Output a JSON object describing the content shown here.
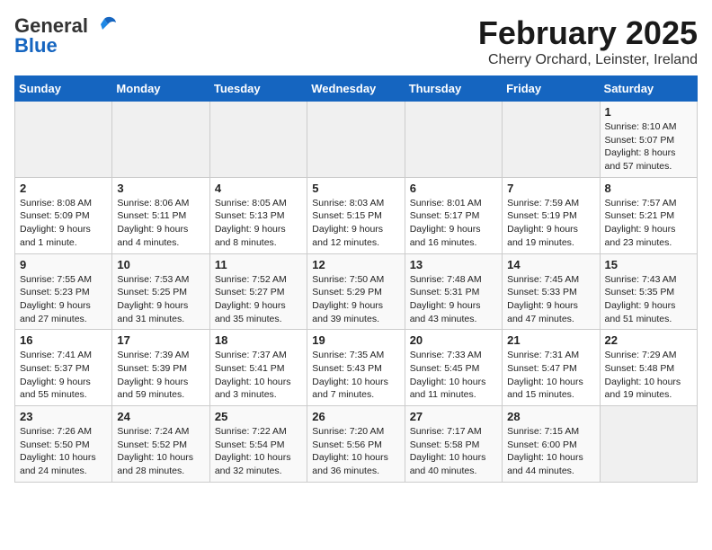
{
  "header": {
    "logo_general": "General",
    "logo_blue": "Blue",
    "month_title": "February 2025",
    "subtitle": "Cherry Orchard, Leinster, Ireland"
  },
  "days_of_week": [
    "Sunday",
    "Monday",
    "Tuesday",
    "Wednesday",
    "Thursday",
    "Friday",
    "Saturday"
  ],
  "weeks": [
    [
      {
        "day": "",
        "info": ""
      },
      {
        "day": "",
        "info": ""
      },
      {
        "day": "",
        "info": ""
      },
      {
        "day": "",
        "info": ""
      },
      {
        "day": "",
        "info": ""
      },
      {
        "day": "",
        "info": ""
      },
      {
        "day": "1",
        "info": "Sunrise: 8:10 AM\nSunset: 5:07 PM\nDaylight: 8 hours and 57 minutes."
      }
    ],
    [
      {
        "day": "2",
        "info": "Sunrise: 8:08 AM\nSunset: 5:09 PM\nDaylight: 9 hours and 1 minute."
      },
      {
        "day": "3",
        "info": "Sunrise: 8:06 AM\nSunset: 5:11 PM\nDaylight: 9 hours and 4 minutes."
      },
      {
        "day": "4",
        "info": "Sunrise: 8:05 AM\nSunset: 5:13 PM\nDaylight: 9 hours and 8 minutes."
      },
      {
        "day": "5",
        "info": "Sunrise: 8:03 AM\nSunset: 5:15 PM\nDaylight: 9 hours and 12 minutes."
      },
      {
        "day": "6",
        "info": "Sunrise: 8:01 AM\nSunset: 5:17 PM\nDaylight: 9 hours and 16 minutes."
      },
      {
        "day": "7",
        "info": "Sunrise: 7:59 AM\nSunset: 5:19 PM\nDaylight: 9 hours and 19 minutes."
      },
      {
        "day": "8",
        "info": "Sunrise: 7:57 AM\nSunset: 5:21 PM\nDaylight: 9 hours and 23 minutes."
      }
    ],
    [
      {
        "day": "9",
        "info": "Sunrise: 7:55 AM\nSunset: 5:23 PM\nDaylight: 9 hours and 27 minutes."
      },
      {
        "day": "10",
        "info": "Sunrise: 7:53 AM\nSunset: 5:25 PM\nDaylight: 9 hours and 31 minutes."
      },
      {
        "day": "11",
        "info": "Sunrise: 7:52 AM\nSunset: 5:27 PM\nDaylight: 9 hours and 35 minutes."
      },
      {
        "day": "12",
        "info": "Sunrise: 7:50 AM\nSunset: 5:29 PM\nDaylight: 9 hours and 39 minutes."
      },
      {
        "day": "13",
        "info": "Sunrise: 7:48 AM\nSunset: 5:31 PM\nDaylight: 9 hours and 43 minutes."
      },
      {
        "day": "14",
        "info": "Sunrise: 7:45 AM\nSunset: 5:33 PM\nDaylight: 9 hours and 47 minutes."
      },
      {
        "day": "15",
        "info": "Sunrise: 7:43 AM\nSunset: 5:35 PM\nDaylight: 9 hours and 51 minutes."
      }
    ],
    [
      {
        "day": "16",
        "info": "Sunrise: 7:41 AM\nSunset: 5:37 PM\nDaylight: 9 hours and 55 minutes."
      },
      {
        "day": "17",
        "info": "Sunrise: 7:39 AM\nSunset: 5:39 PM\nDaylight: 9 hours and 59 minutes."
      },
      {
        "day": "18",
        "info": "Sunrise: 7:37 AM\nSunset: 5:41 PM\nDaylight: 10 hours and 3 minutes."
      },
      {
        "day": "19",
        "info": "Sunrise: 7:35 AM\nSunset: 5:43 PM\nDaylight: 10 hours and 7 minutes."
      },
      {
        "day": "20",
        "info": "Sunrise: 7:33 AM\nSunset: 5:45 PM\nDaylight: 10 hours and 11 minutes."
      },
      {
        "day": "21",
        "info": "Sunrise: 7:31 AM\nSunset: 5:47 PM\nDaylight: 10 hours and 15 minutes."
      },
      {
        "day": "22",
        "info": "Sunrise: 7:29 AM\nSunset: 5:48 PM\nDaylight: 10 hours and 19 minutes."
      }
    ],
    [
      {
        "day": "23",
        "info": "Sunrise: 7:26 AM\nSunset: 5:50 PM\nDaylight: 10 hours and 24 minutes."
      },
      {
        "day": "24",
        "info": "Sunrise: 7:24 AM\nSunset: 5:52 PM\nDaylight: 10 hours and 28 minutes."
      },
      {
        "day": "25",
        "info": "Sunrise: 7:22 AM\nSunset: 5:54 PM\nDaylight: 10 hours and 32 minutes."
      },
      {
        "day": "26",
        "info": "Sunrise: 7:20 AM\nSunset: 5:56 PM\nDaylight: 10 hours and 36 minutes."
      },
      {
        "day": "27",
        "info": "Sunrise: 7:17 AM\nSunset: 5:58 PM\nDaylight: 10 hours and 40 minutes."
      },
      {
        "day": "28",
        "info": "Sunrise: 7:15 AM\nSunset: 6:00 PM\nDaylight: 10 hours and 44 minutes."
      },
      {
        "day": "",
        "info": ""
      }
    ]
  ]
}
